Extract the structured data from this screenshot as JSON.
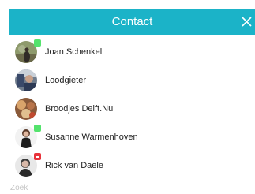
{
  "header": {
    "title": "Contact",
    "background": "#1bb3c8",
    "close_icon": "close-icon"
  },
  "contacts": [
    {
      "name": "Joan Schenkel",
      "status": "online",
      "status_color": "#54e36d"
    },
    {
      "name": "Loodgieter",
      "status": "none"
    },
    {
      "name": "Broodjes Delft.Nu",
      "status": "none"
    },
    {
      "name": "Susanne Warmenhoven",
      "status": "online",
      "status_color": "#54e36d"
    },
    {
      "name": "Rick van Daele",
      "status": "busy",
      "status_color": "#e8333b"
    }
  ],
  "search": {
    "placeholder": "Zoek",
    "value": ""
  }
}
